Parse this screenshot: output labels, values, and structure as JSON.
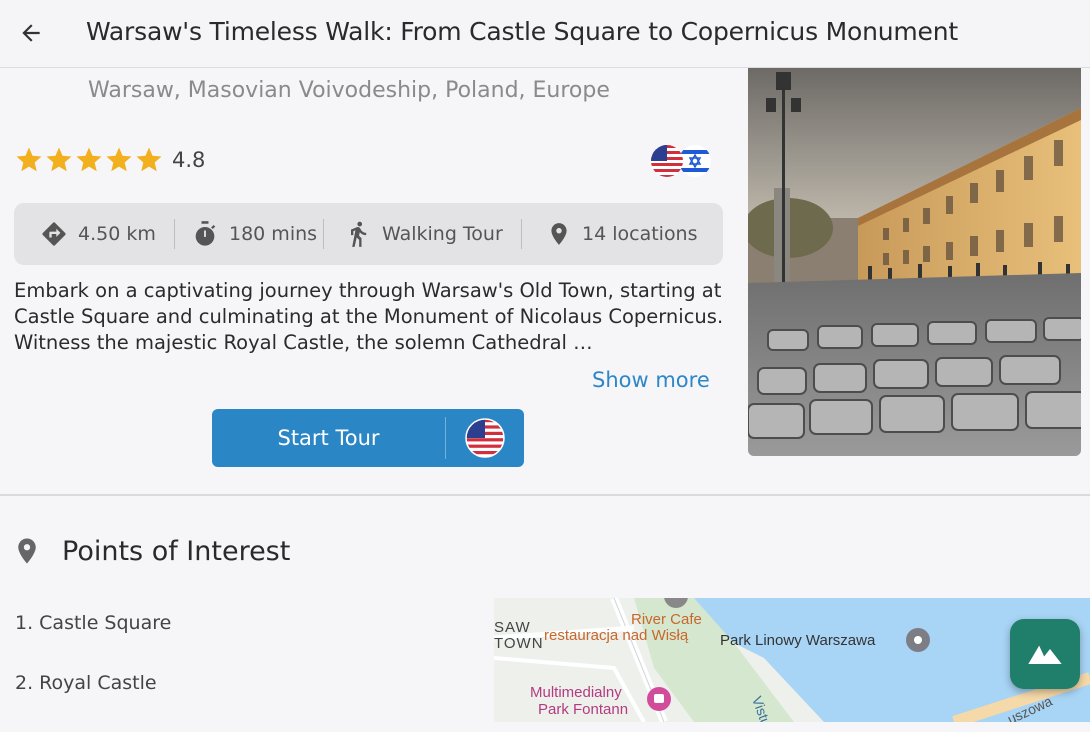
{
  "header": {
    "title": "Warsaw's Timeless Walk: From Castle Square to Copernicus Monument"
  },
  "tour": {
    "location": "Warsaw, Masovian Voivodeship, Poland, Europe",
    "rating": "4.8",
    "rating_stars": 5,
    "languages_icon": "us-israel-flags-icon",
    "stats": {
      "distance": "4.50 km",
      "duration": "180 mins",
      "type": "Walking Tour",
      "locations": "14 locations"
    },
    "description": "Embark on a captivating journey through Warsaw's Old Town, starting at Castle Square and culminating at the Monument of Nicolaus Copernicus. Witness the majestic Royal Castle, the solemn Cathedral …",
    "show_more_label": "Show more",
    "start_button_label": "Start Tour"
  },
  "poi": {
    "title": "Points of Interest",
    "items": [
      "1. Castle Square",
      "2. Royal Castle"
    ]
  },
  "map": {
    "labels": {
      "river_cafe": "River Cafe",
      "restauracja": "restauracja nad Wisłą",
      "park_linowy": "Park Linowy Warszawa",
      "saw": "SAW",
      "town": "TOWN",
      "multimedialny": "Multimedialny",
      "park_fontann": "Park Fontann",
      "vistula": "Vistula",
      "uszowa": "uszowa"
    }
  },
  "colors": {
    "accent": "#2a86c5",
    "link": "#2d86c8",
    "star": "#f2b01e",
    "fab": "#1f7f6b",
    "river": "#a8d4f5"
  }
}
